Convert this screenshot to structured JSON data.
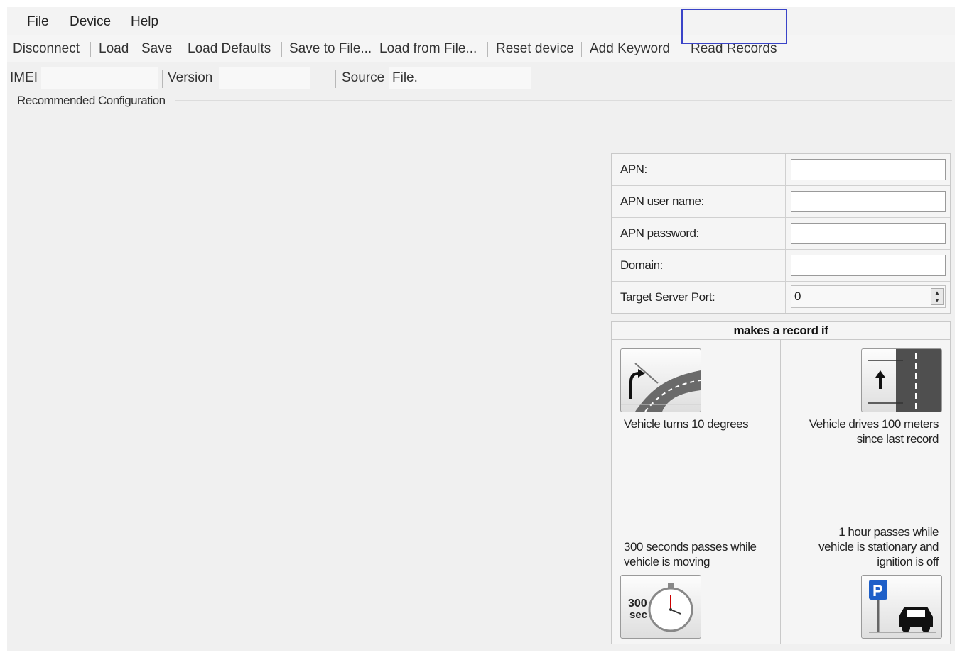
{
  "menu": {
    "file": "File",
    "device": "Device",
    "help": "Help"
  },
  "toolbar": {
    "disconnect": "Disconnect",
    "load": "Load",
    "save": "Save",
    "load_defaults": "Load Defaults",
    "save_to_file": "Save to File...",
    "load_from_file": "Load from File...",
    "reset_device": "Reset device",
    "add_keyword": "Add Keyword",
    "read_records": "Read Records",
    "highlight_color": "#3a44c8"
  },
  "info": {
    "imei_label": "IMEI",
    "imei_value": "",
    "version_label": "Version",
    "version_value": "",
    "source_label": "Source",
    "source_value": "File."
  },
  "group": {
    "title": "Recommended Configuration"
  },
  "settings": {
    "apn_label": "APN:",
    "apn_value": "",
    "apn_user_label": "APN user name:",
    "apn_user_value": "",
    "apn_password_label": "APN password:",
    "apn_password_value": "",
    "domain_label": "Domain:",
    "domain_value": "",
    "port_label": "Target Server Port:",
    "port_value": "0"
  },
  "record": {
    "header": "makes a record if",
    "turn_line1": "Vehicle turns 10 degrees",
    "distance_line1": "Vehicle drives 100 meters",
    "distance_line2": "since last record",
    "time_line1": "300 seconds passes while",
    "time_line2": "vehicle is moving",
    "stationary_line1": "1 hour passes while",
    "stationary_line2": "vehicle is stationary and",
    "stationary_line3": "ignition is off",
    "stopwatch_num": "300",
    "stopwatch_unit": "sec",
    "parking_letter": "P",
    "icons": [
      "turn-road-icon",
      "distance-road-icon",
      "stopwatch-icon",
      "parking-car-icon"
    ]
  }
}
